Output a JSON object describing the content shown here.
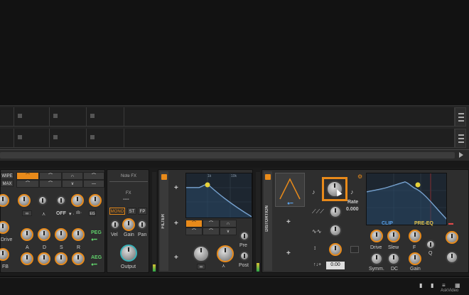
{
  "poly": {
    "wipe": "WIPE",
    "max": "MAX",
    "labels": {
      "drive": "Drive",
      "fb": "FB",
      "a": "A",
      "d": "D",
      "s": "S",
      "r": "R",
      "off": "OFF",
      "eg": "EG",
      "peg": "PEG",
      "aeg": "AEG"
    }
  },
  "notefx": {
    "title": "Note FX",
    "fx": "FX",
    "mono": "MONO",
    "st": "ST",
    "fp": "FP",
    "vel": "Vel",
    "gain": "Gain",
    "pan": "Pan",
    "output": "Output"
  },
  "filter": {
    "title": "FILTER",
    "pre": "Pre",
    "post": "Post"
  },
  "distortion": {
    "title": "DISTORTION",
    "rate_label": "Rate",
    "rate_value": "0.000",
    "bottom_value": "0.00",
    "clip": "CLIP",
    "pre_eq": "PRE-EQ",
    "drive": "Drive",
    "slew": "Slew",
    "symm": "Symm.",
    "dc": "DC",
    "f": "F",
    "q": "Q",
    "gain": "Gain"
  },
  "graph_labels": {
    "f1": "1k",
    "f2": "10k"
  },
  "watermark": "AskVideo",
  "colors": {
    "accent": "#e88a1a",
    "teal": "#38b2b8",
    "green": "#5fcf6a",
    "blue": "#5aa0e8",
    "yellow": "#e8c64a",
    "red": "#e04a4a"
  }
}
